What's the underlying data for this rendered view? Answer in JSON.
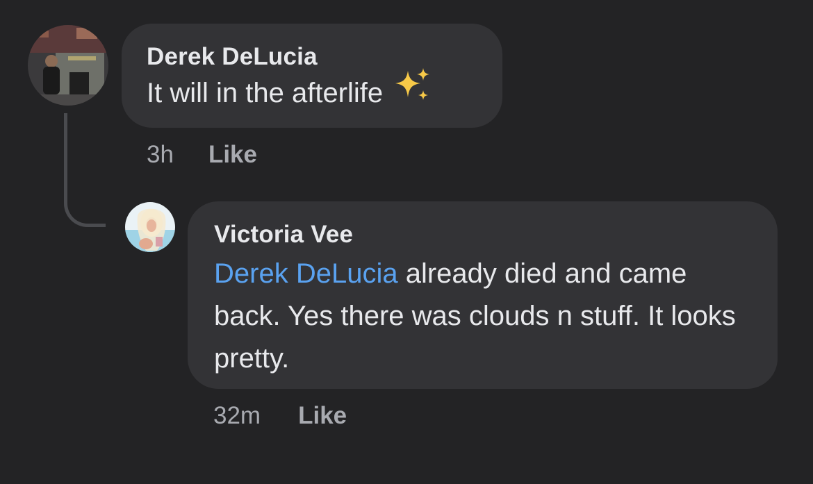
{
  "comments": [
    {
      "author": "Derek DeLucia",
      "text": "It will in the afterlife",
      "emoji": "sparkles-icon",
      "time": "3h",
      "like_label": "Like"
    }
  ],
  "reply": {
    "author": "Victoria Vee",
    "mention": "Derek DeLucia",
    "text": " already died and came back. Yes there was clouds n stuff. It looks pretty.",
    "time": "32m",
    "like_label": "Like"
  },
  "colors": {
    "background": "#232325",
    "bubble": "#333336",
    "mention": "#5aa2f0",
    "sparkle": "#f7c948"
  }
}
